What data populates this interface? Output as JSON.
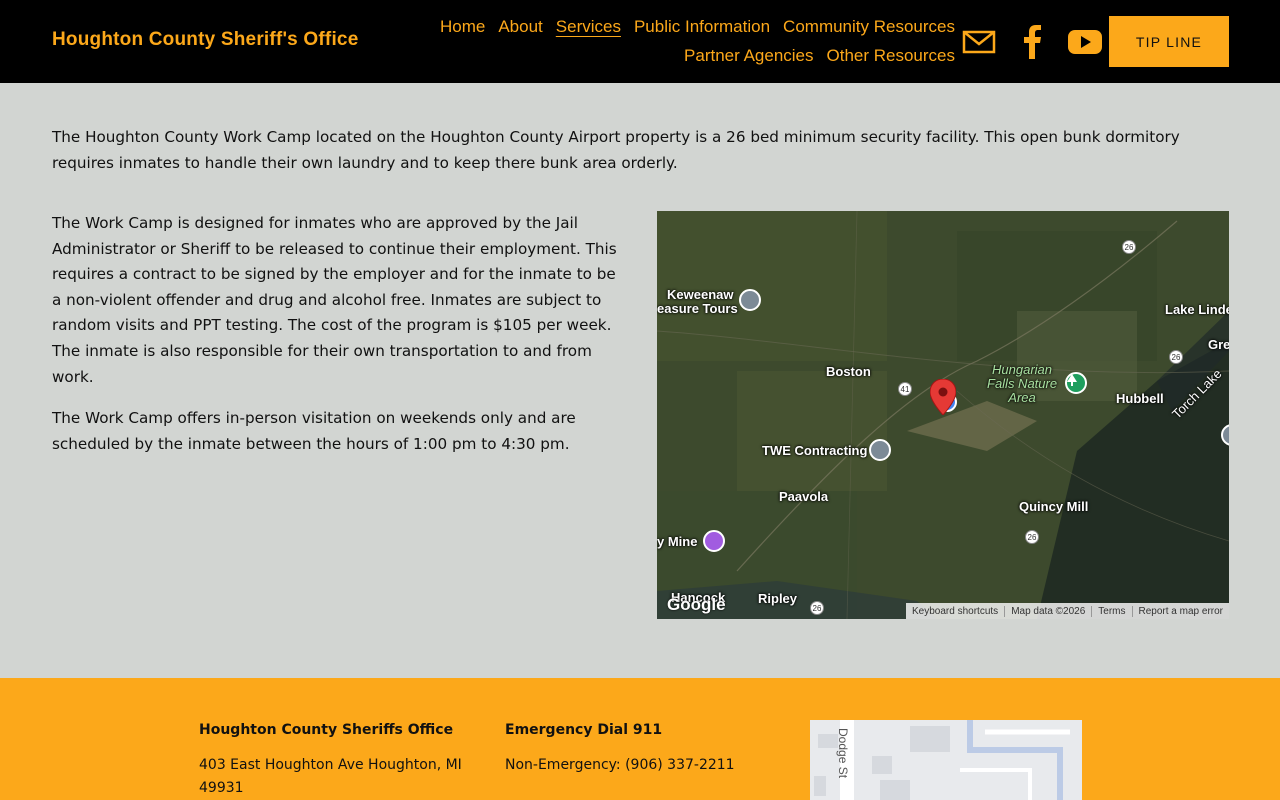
{
  "header": {
    "site_title": "Houghton County Sheriff's Office",
    "nav_row1": [
      "Home",
      "About",
      "Services",
      "Public Information",
      "Community Resources"
    ],
    "nav_row2": [
      "Partner Agencies",
      "Other Resources"
    ],
    "active_nav": "Services",
    "social_icons": [
      "mail-icon",
      "facebook-icon",
      "youtube-icon"
    ],
    "tip_button": "TIP LINE",
    "colors": {
      "background": "#000000",
      "accent": "#fca81a"
    }
  },
  "main": {
    "intro": "The Houghton County Work Camp located on the Houghton County Airport property is a 26 bed minimum security facility. This open bunk dormitory requires inmates to handle their own laundry and to keep there bunk area orderly.",
    "paragraph1": "The Work Camp is designed for inmates who are approved by the Jail Administrator or Sheriff to be released to continue their employment. This requires a contract to be signed by the employer and for the inmate to be a non-violent offender and drug and alcohol free. Inmates are subject to random visits and PPT testing. The cost of the program is $105 per week. The inmate is also responsible for their own transportation to and from work.",
    "paragraph2": "The Work Camp offers in-person visitation on weekends only and are scheduled by the inmate between the hours of 1:00 pm to 4:30 pm.",
    "background_color": "#d2d5d2"
  },
  "map": {
    "labels": {
      "keweenaw_1": "Keweenaw",
      "keweenaw_2": "easure Tours",
      "lake_linden": "Lake Linde",
      "gre": "Gre",
      "boston": "Boston",
      "hungarian_1": "Hungarian",
      "hungarian_2": "Falls Nature",
      "hungarian_3": "Area",
      "hubbell": "Hubbell",
      "torch_lake": "Torch Lake",
      "twe": "TWE Contracting",
      "paavola": "Paavola",
      "quincy_mill": "Quincy Mill",
      "mine": "y Mine",
      "hancock": "Hancock",
      "ripley": "Ripley"
    },
    "route_shields": [
      "26",
      "26",
      "41",
      "26",
      "26"
    ],
    "logo": "Google",
    "attribution": [
      "Keyboard shortcuts",
      "Map data ©2026",
      "Terms",
      "Report a map error"
    ]
  },
  "footer": {
    "col1_head": "Houghton County Sheriffs Office",
    "col1_address_1": "403 East Houghton Ave Houghton, MI",
    "col1_address_2": "49931",
    "col2_head": "Emergency Dial 911",
    "col2_line": "Non-Emergency: (906) 337-2211",
    "mini_map_street": "Dodge St",
    "background_color": "#fca81a"
  }
}
